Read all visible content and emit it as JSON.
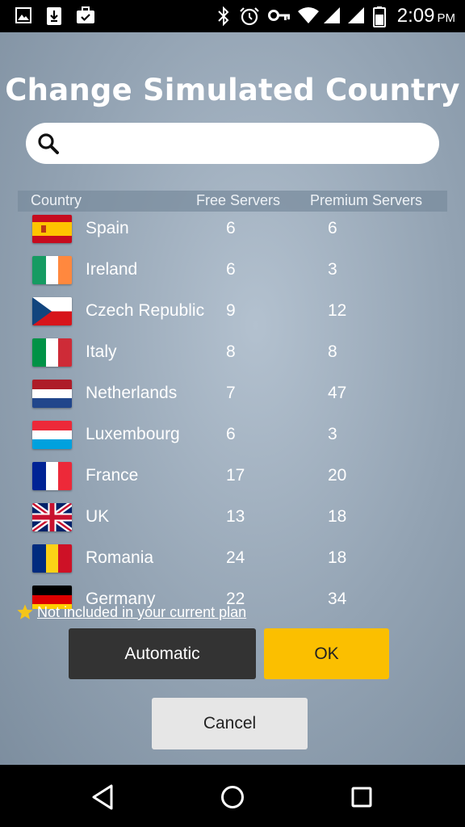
{
  "status_bar": {
    "time": "2:09",
    "ampm": "PM",
    "icons": [
      "image-icon",
      "download-icon",
      "briefcase-icon",
      "bluetooth-icon",
      "alarm-icon",
      "vpn-key-icon",
      "wifi-icon",
      "signal-icon",
      "signal-icon",
      "battery-icon"
    ]
  },
  "dialog": {
    "title": "Change Simulated Country",
    "search": {
      "value": "",
      "placeholder": ""
    },
    "columns": {
      "country": "Country",
      "free": "Free Servers",
      "premium": "Premium Servers"
    },
    "rows": [
      {
        "country": "Spain",
        "free": "6",
        "premium": "6",
        "flag": "spain-flag"
      },
      {
        "country": "Ireland",
        "free": "6",
        "premium": "3",
        "flag": "ireland-flag"
      },
      {
        "country": "Czech Republic",
        "free": "9",
        "premium": "12",
        "flag": "czech-flag"
      },
      {
        "country": "Italy",
        "free": "8",
        "premium": "8",
        "flag": "italy-flag"
      },
      {
        "country": "Netherlands",
        "free": "7",
        "premium": "47",
        "flag": "netherlands-flag"
      },
      {
        "country": "Luxembourg",
        "free": "6",
        "premium": "3",
        "flag": "luxembourg-flag"
      },
      {
        "country": "France",
        "free": "17",
        "premium": "20",
        "flag": "france-flag"
      },
      {
        "country": "UK",
        "free": "13",
        "premium": "18",
        "flag": "uk-flag"
      },
      {
        "country": "Romania",
        "free": "24",
        "premium": "18",
        "flag": "romania-flag"
      },
      {
        "country": "Germany",
        "free": "22",
        "premium": "34",
        "flag": "germany-flag"
      }
    ],
    "note": "Not included in your current plan",
    "buttons": {
      "automatic": "Automatic",
      "ok": "OK",
      "cancel": "Cancel"
    }
  },
  "colors": {
    "ok_button": "#fbbf00",
    "automatic_button": "#333333",
    "cancel_button": "#e6e6e6",
    "note_star": "#f5c518"
  }
}
